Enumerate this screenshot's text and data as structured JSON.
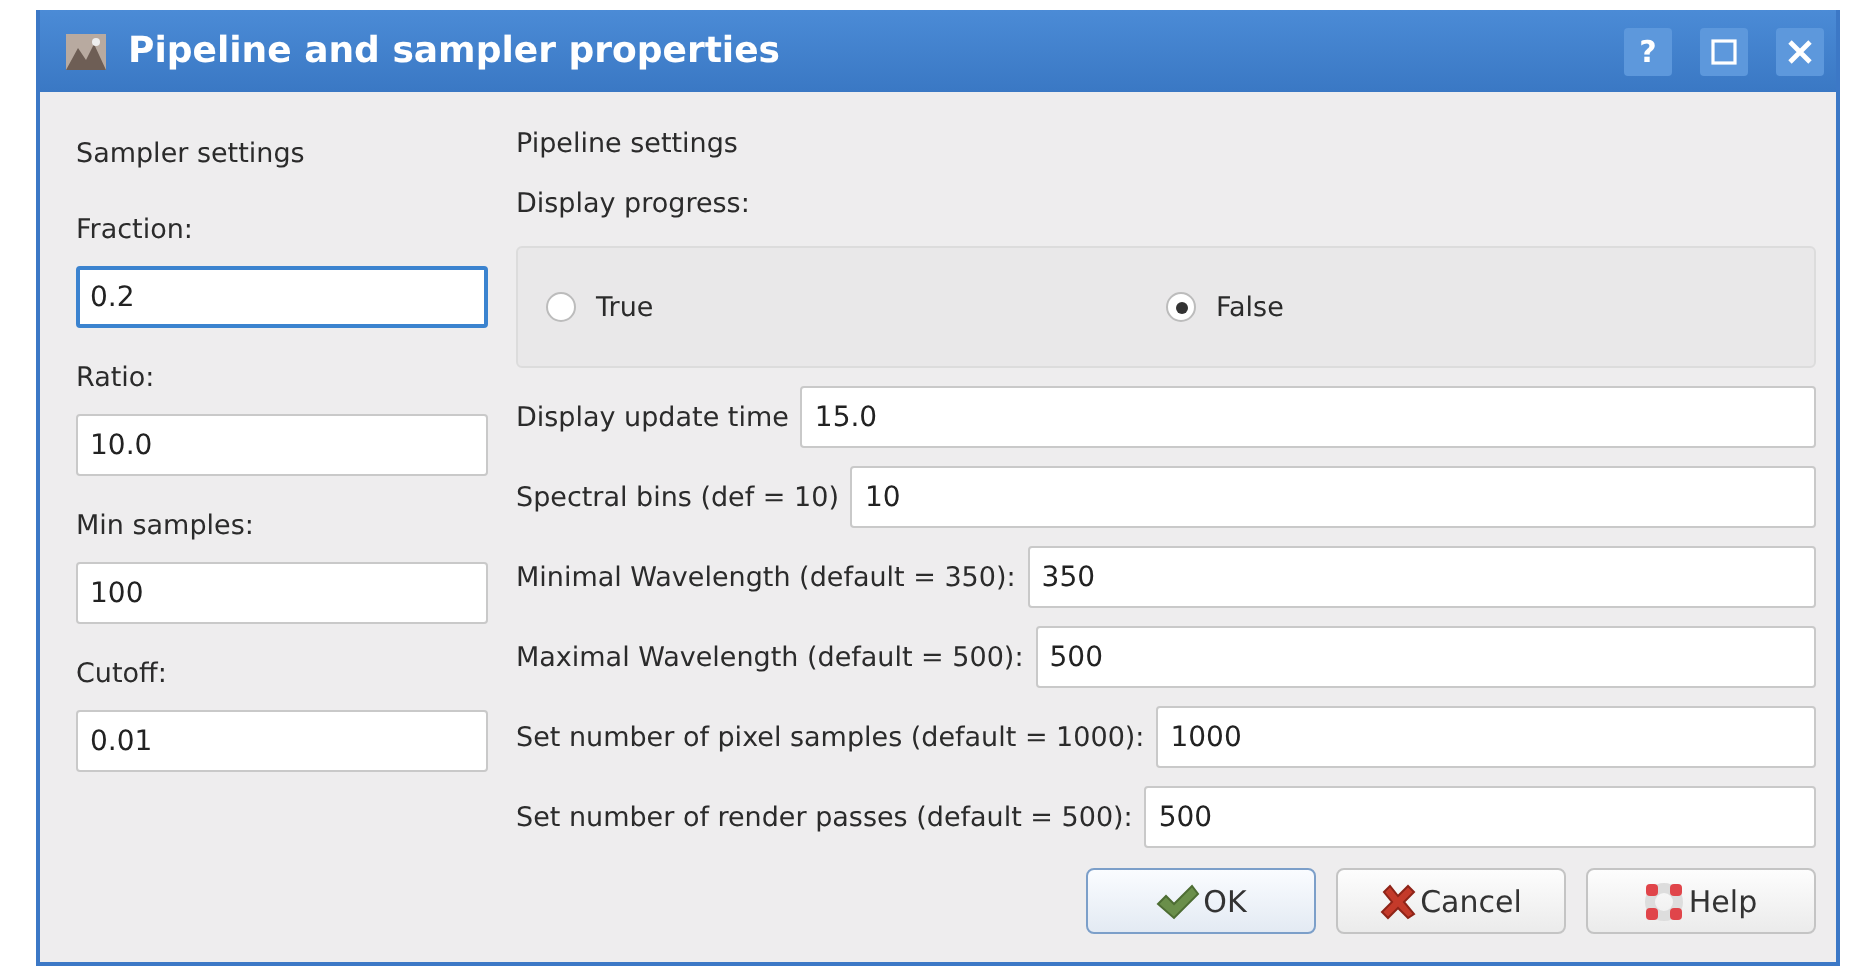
{
  "window": {
    "title": "Pipeline and sampler properties",
    "help_button": "?"
  },
  "sampler": {
    "heading": "Sampler settings",
    "fields": [
      {
        "label": "Fraction:",
        "value": "0.2",
        "focused": true
      },
      {
        "label": "Ratio:",
        "value": "10.0",
        "focused": false
      },
      {
        "label": "Min samples:",
        "value": "100",
        "focused": false
      },
      {
        "label": "Cutoff:",
        "value": "0.01",
        "focused": false
      }
    ]
  },
  "pipeline": {
    "heading": "Pipeline settings",
    "progress_label": "Display progress:",
    "radios": [
      {
        "label": "True",
        "selected": false
      },
      {
        "label": "False",
        "selected": true
      }
    ],
    "fields": [
      {
        "label": "Display update time",
        "value": "15.0"
      },
      {
        "label": "Spectral bins (def = 10)",
        "value": "10"
      },
      {
        "label": "Minimal Wavelength (default = 350):",
        "value": "350"
      },
      {
        "label": "Maximal Wavelength (default = 500):",
        "value": "500"
      },
      {
        "label": "Set number of pixel samples (default = 1000):",
        "value": "1000"
      },
      {
        "label": "Set number of render passes (default = 500):",
        "value": "500"
      }
    ]
  },
  "buttons": [
    {
      "kind": "ok",
      "label": "OK"
    },
    {
      "kind": "cancel",
      "label": "Cancel"
    },
    {
      "kind": "help",
      "label": "Help"
    }
  ]
}
